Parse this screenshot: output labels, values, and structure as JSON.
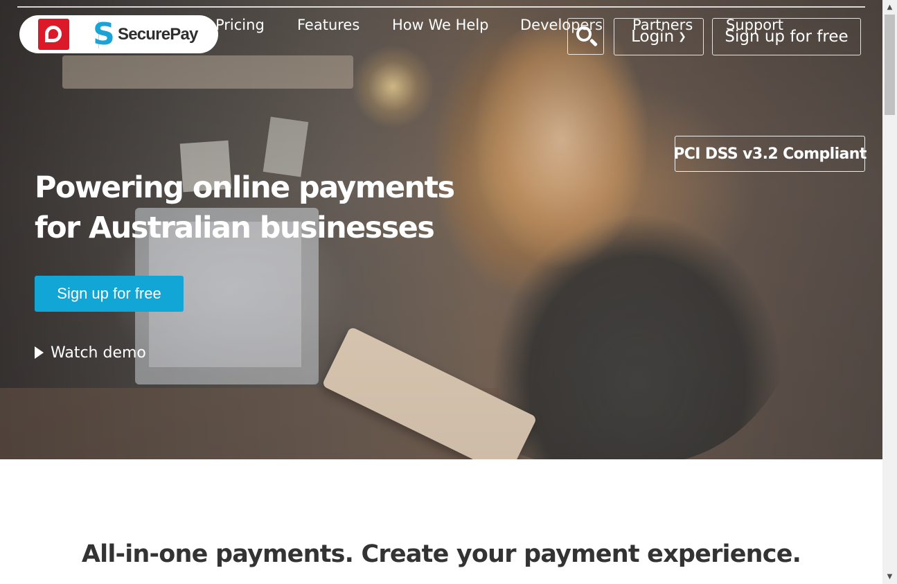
{
  "header": {
    "logo_left": "Australia Post",
    "logo_brand": "SecurePay",
    "nav": [
      {
        "label": "Pricing"
      },
      {
        "label": "Features"
      },
      {
        "label": "How We Help"
      },
      {
        "label": "Developers"
      },
      {
        "label": "Partners"
      },
      {
        "label": "Support"
      }
    ],
    "search_icon": "search-icon",
    "login_label": "Login",
    "signup_label": "Sign up for free"
  },
  "hero": {
    "badge": "PCI DSS v3.2 Compliant",
    "headline_line1": "Powering online payments",
    "headline_line2": "for Australian businesses",
    "cta_label": "Sign up for free",
    "watch_demo_label": "Watch demo"
  },
  "section": {
    "tagline": "All-in-one payments. Create your payment experience."
  },
  "colors": {
    "accent": "#12a6d6",
    "brand_red": "#dc1928",
    "brand_blue": "#1aa3d6"
  }
}
